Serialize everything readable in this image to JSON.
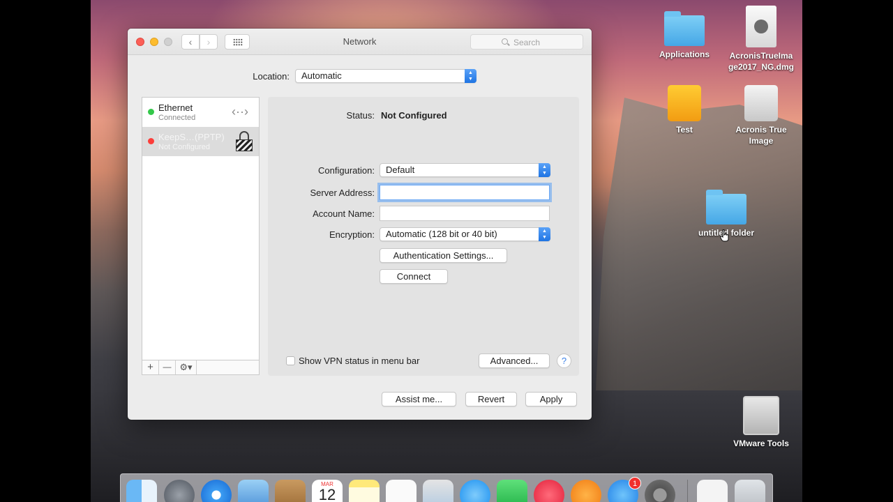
{
  "window": {
    "title": "Network",
    "search_placeholder": "Search",
    "location_label": "Location:",
    "location_value": "Automatic"
  },
  "services": [
    {
      "name": "Ethernet",
      "status": "Connected",
      "status_color": "#34c84a"
    },
    {
      "name": "KeepS…(PPTP)",
      "status": "Not Configured",
      "status_color": "#fc3d39"
    }
  ],
  "list_tools": {
    "add": "+",
    "remove": "—",
    "gear": "⚙▾"
  },
  "detail": {
    "status_label": "Status:",
    "status_value": "Not Configured",
    "configuration_label": "Configuration:",
    "configuration_value": "Default",
    "server_label": "Server Address:",
    "server_value": "",
    "account_label": "Account Name:",
    "account_value": "",
    "encryption_label": "Encryption:",
    "encryption_value": "Automatic (128 bit or 40 bit)",
    "auth_button": "Authentication Settings...",
    "connect_button": "Connect",
    "vpn_status_checkbox": "Show VPN status in menu bar",
    "advanced_button": "Advanced...",
    "help_button": "?"
  },
  "footer": {
    "assist_button": "Assist me...",
    "revert_button": "Revert",
    "apply_button": "Apply"
  },
  "desktop_icons": [
    {
      "label": "Applications"
    },
    {
      "label": "AcronisTrueIma ge2017_NG.dmg"
    },
    {
      "label": "Test"
    },
    {
      "label": "Acronis True Image"
    },
    {
      "label": "untitled folder"
    },
    {
      "label": "VMware Tools"
    }
  ],
  "dock": {
    "calendar_month": "MAR",
    "calendar_day": "12",
    "appstore_badge": "1"
  }
}
